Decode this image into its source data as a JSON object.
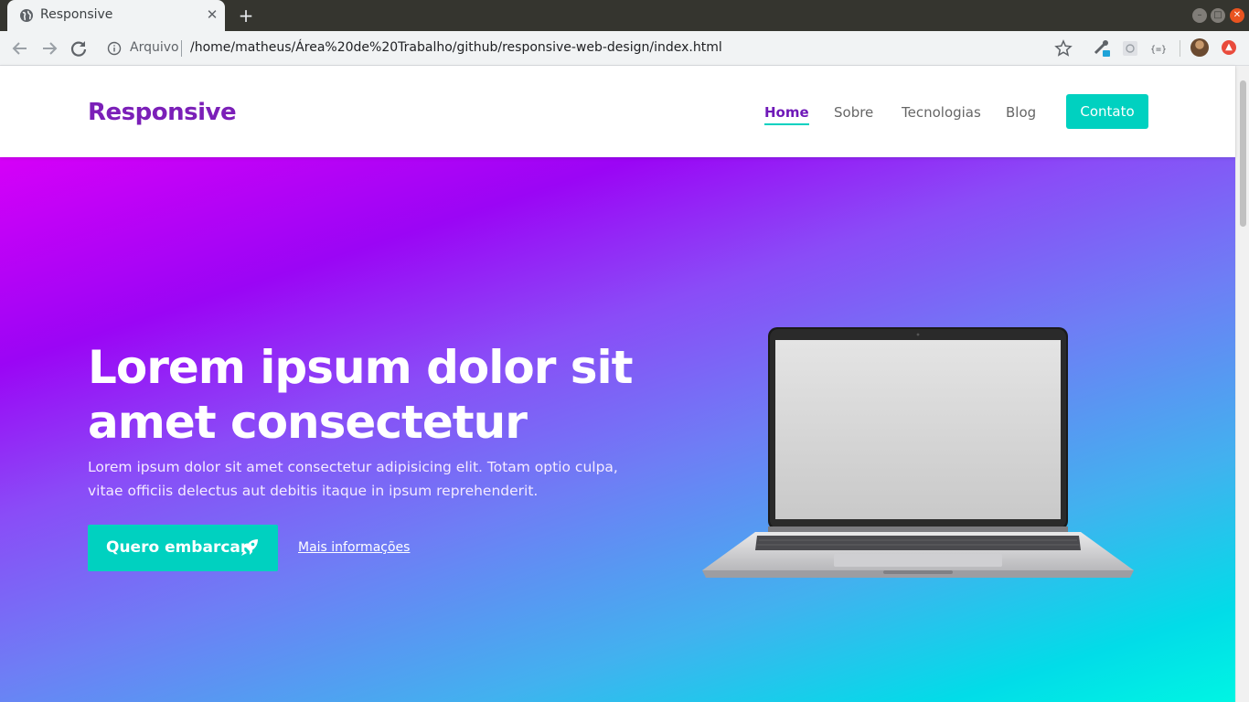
{
  "browser": {
    "tab_title": "Responsive",
    "new_tab_symbol": "+",
    "close_symbol": "✕",
    "scheme_label": "Arquivo",
    "url": "/home/matheus/Área%20de%20Trabalho/github/responsive-web-design/index.html",
    "icons": [
      "globe-icon",
      "back-icon",
      "forward-icon",
      "reload-icon",
      "info-icon",
      "star-icon",
      "extension-icon",
      "avatar",
      "update-icon"
    ]
  },
  "site": {
    "brand": "Responsive",
    "nav": [
      {
        "label": "Home",
        "active": true
      },
      {
        "label": "Sobre",
        "active": false
      },
      {
        "label": "Tecnologias",
        "active": false
      },
      {
        "label": "Blog",
        "active": false
      }
    ],
    "contact_label": "Contato"
  },
  "hero": {
    "title": "Lorem ipsum dolor sit amet consectetur",
    "text": "Lorem ipsum dolor sit amet consectetur adipisicing elit. Totam optio culpa, vitae officiis delectus aut debitis itaque in ipsum reprehenderit.",
    "cta_label": "Quero embarcar",
    "more_label": "Mais informações",
    "image": "laptop"
  },
  "colors": {
    "brand": "#7b1fb8",
    "accent": "#00d1c0",
    "gradient_start": "#d600f8",
    "gradient_end": "#00f5e3"
  }
}
